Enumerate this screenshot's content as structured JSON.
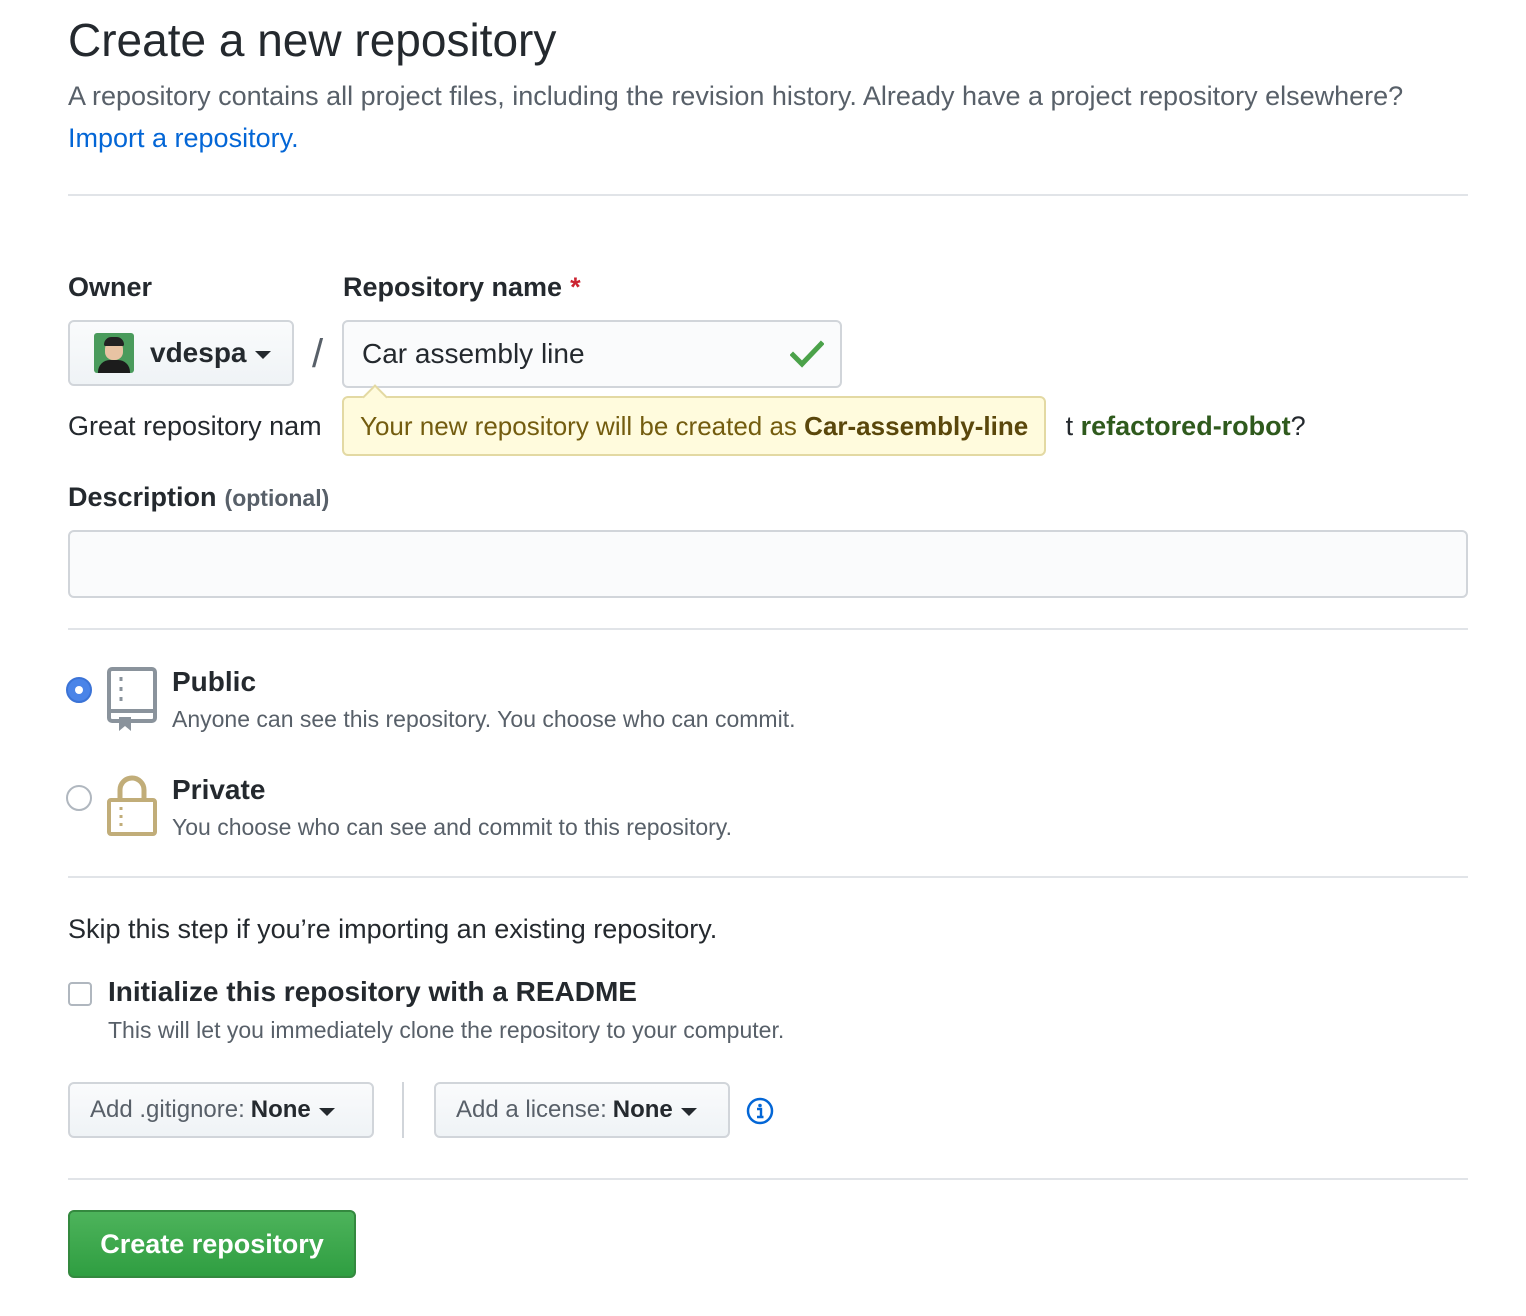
{
  "header": {
    "title": "Create a new repository",
    "subtitle": "A repository contains all project files, including the revision history. Already have a project repository elsewhere?",
    "import_link": "Import a repository."
  },
  "owner": {
    "label": "Owner",
    "value": "vdespa"
  },
  "repo_name": {
    "label": "Repository name",
    "required_mark": "*",
    "separator": "/",
    "value": "Car assembly line"
  },
  "hint": {
    "prefix": "Great repository nam",
    "middle": "t",
    "suggestion": "refactored-robot",
    "suffix": "?"
  },
  "tooltip": {
    "text": "Your new repository will be created as",
    "name": "Car-assembly-line"
  },
  "description": {
    "label": "Description",
    "optional": "(optional)",
    "value": ""
  },
  "visibility": {
    "public": {
      "title": "Public",
      "desc": "Anyone can see this repository. You choose who can commit."
    },
    "private": {
      "title": "Private",
      "desc": "You choose who can see and commit to this repository."
    },
    "selected": "Public"
  },
  "init": {
    "skip_text": "Skip this step if you’re importing an existing repository.",
    "readme_label": "Initialize this repository with a README",
    "readme_desc": "This will let you immediately clone the repository to your computer.",
    "readme_checked": false
  },
  "gitignore": {
    "label": "Add .gitignore:",
    "value": "None"
  },
  "license": {
    "label": "Add a license:",
    "value": "None"
  },
  "submit": {
    "label": "Create repository"
  },
  "colors": {
    "link": "#0366d6",
    "primary_button": "#2f9e41",
    "radio_selected": "#4a84e8",
    "tooltip_bg": "#fffbdd",
    "valid_check": "#4ba24a"
  },
  "icons": {
    "check": "check-icon",
    "public_repo": "repo-icon",
    "private_repo": "lock-icon",
    "info": "info-icon",
    "dropdown": "chevron-down-icon"
  }
}
